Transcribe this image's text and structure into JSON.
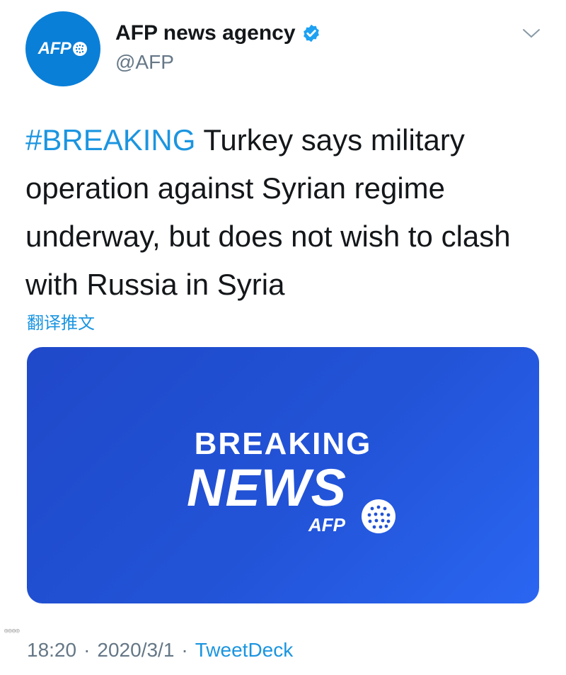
{
  "author": {
    "name": "AFP news agency",
    "handle": "@AFP",
    "avatar_text": "AFP",
    "verified_icon": "verified-badge-icon"
  },
  "tweet": {
    "hashtag": "#BREAKING",
    "body": " Turkey says military operation against Syrian regime underway, but does not wish to clash with Russia in Syria",
    "translate_label": "翻译推文"
  },
  "media": {
    "line1": "BREAKING",
    "line2": "NEWS",
    "brand": "AFP"
  },
  "meta": {
    "time": "18:20",
    "date": "2020/3/1",
    "separator": "·",
    "source": "TweetDeck"
  },
  "colors": {
    "link": "#1b95e0",
    "avatar": "#0a7fd8",
    "media_bg": "#2253d7",
    "muted": "#657786"
  }
}
